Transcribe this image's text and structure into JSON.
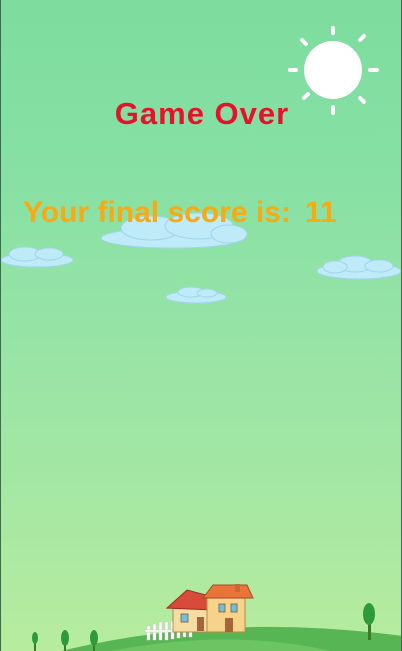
{
  "game_over": {
    "title": "Game Over",
    "score_label": "Your final score is:",
    "score_value": "11"
  },
  "colors": {
    "title": "#e8102a",
    "score": "#f8aa12",
    "sky_top": "#7ddc9e",
    "sky_bottom": "#b7ec9e"
  },
  "icons": [
    "sun-icon",
    "cloud-icon",
    "house-icon",
    "tree-icon",
    "fence-icon",
    "hill-icon"
  ]
}
